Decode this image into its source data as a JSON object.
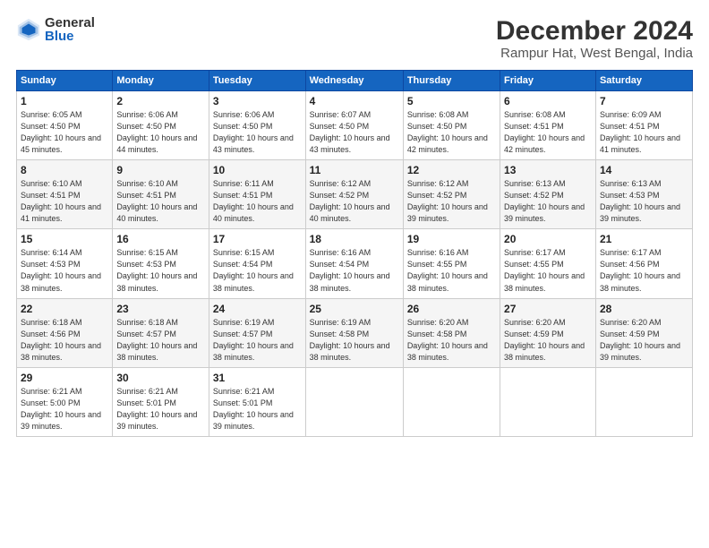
{
  "logo": {
    "general": "General",
    "blue": "Blue"
  },
  "title": "December 2024",
  "subtitle": "Rampur Hat, West Bengal, India",
  "weekdays": [
    "Sunday",
    "Monday",
    "Tuesday",
    "Wednesday",
    "Thursday",
    "Friday",
    "Saturday"
  ],
  "weeks": [
    [
      {
        "day": "1",
        "sunrise": "6:05 AM",
        "sunset": "4:50 PM",
        "daylight": "10 hours and 45 minutes."
      },
      {
        "day": "2",
        "sunrise": "6:06 AM",
        "sunset": "4:50 PM",
        "daylight": "10 hours and 44 minutes."
      },
      {
        "day": "3",
        "sunrise": "6:06 AM",
        "sunset": "4:50 PM",
        "daylight": "10 hours and 43 minutes."
      },
      {
        "day": "4",
        "sunrise": "6:07 AM",
        "sunset": "4:50 PM",
        "daylight": "10 hours and 43 minutes."
      },
      {
        "day": "5",
        "sunrise": "6:08 AM",
        "sunset": "4:50 PM",
        "daylight": "10 hours and 42 minutes."
      },
      {
        "day": "6",
        "sunrise": "6:08 AM",
        "sunset": "4:51 PM",
        "daylight": "10 hours and 42 minutes."
      },
      {
        "day": "7",
        "sunrise": "6:09 AM",
        "sunset": "4:51 PM",
        "daylight": "10 hours and 41 minutes."
      }
    ],
    [
      {
        "day": "8",
        "sunrise": "6:10 AM",
        "sunset": "4:51 PM",
        "daylight": "10 hours and 41 minutes."
      },
      {
        "day": "9",
        "sunrise": "6:10 AM",
        "sunset": "4:51 PM",
        "daylight": "10 hours and 40 minutes."
      },
      {
        "day": "10",
        "sunrise": "6:11 AM",
        "sunset": "4:51 PM",
        "daylight": "10 hours and 40 minutes."
      },
      {
        "day": "11",
        "sunrise": "6:12 AM",
        "sunset": "4:52 PM",
        "daylight": "10 hours and 40 minutes."
      },
      {
        "day": "12",
        "sunrise": "6:12 AM",
        "sunset": "4:52 PM",
        "daylight": "10 hours and 39 minutes."
      },
      {
        "day": "13",
        "sunrise": "6:13 AM",
        "sunset": "4:52 PM",
        "daylight": "10 hours and 39 minutes."
      },
      {
        "day": "14",
        "sunrise": "6:13 AM",
        "sunset": "4:53 PM",
        "daylight": "10 hours and 39 minutes."
      }
    ],
    [
      {
        "day": "15",
        "sunrise": "6:14 AM",
        "sunset": "4:53 PM",
        "daylight": "10 hours and 38 minutes."
      },
      {
        "day": "16",
        "sunrise": "6:15 AM",
        "sunset": "4:53 PM",
        "daylight": "10 hours and 38 minutes."
      },
      {
        "day": "17",
        "sunrise": "6:15 AM",
        "sunset": "4:54 PM",
        "daylight": "10 hours and 38 minutes."
      },
      {
        "day": "18",
        "sunrise": "6:16 AM",
        "sunset": "4:54 PM",
        "daylight": "10 hours and 38 minutes."
      },
      {
        "day": "19",
        "sunrise": "6:16 AM",
        "sunset": "4:55 PM",
        "daylight": "10 hours and 38 minutes."
      },
      {
        "day": "20",
        "sunrise": "6:17 AM",
        "sunset": "4:55 PM",
        "daylight": "10 hours and 38 minutes."
      },
      {
        "day": "21",
        "sunrise": "6:17 AM",
        "sunset": "4:56 PM",
        "daylight": "10 hours and 38 minutes."
      }
    ],
    [
      {
        "day": "22",
        "sunrise": "6:18 AM",
        "sunset": "4:56 PM",
        "daylight": "10 hours and 38 minutes."
      },
      {
        "day": "23",
        "sunrise": "6:18 AM",
        "sunset": "4:57 PM",
        "daylight": "10 hours and 38 minutes."
      },
      {
        "day": "24",
        "sunrise": "6:19 AM",
        "sunset": "4:57 PM",
        "daylight": "10 hours and 38 minutes."
      },
      {
        "day": "25",
        "sunrise": "6:19 AM",
        "sunset": "4:58 PM",
        "daylight": "10 hours and 38 minutes."
      },
      {
        "day": "26",
        "sunrise": "6:20 AM",
        "sunset": "4:58 PM",
        "daylight": "10 hours and 38 minutes."
      },
      {
        "day": "27",
        "sunrise": "6:20 AM",
        "sunset": "4:59 PM",
        "daylight": "10 hours and 38 minutes."
      },
      {
        "day": "28",
        "sunrise": "6:20 AM",
        "sunset": "4:59 PM",
        "daylight": "10 hours and 39 minutes."
      }
    ],
    [
      {
        "day": "29",
        "sunrise": "6:21 AM",
        "sunset": "5:00 PM",
        "daylight": "10 hours and 39 minutes."
      },
      {
        "day": "30",
        "sunrise": "6:21 AM",
        "sunset": "5:01 PM",
        "daylight": "10 hours and 39 minutes."
      },
      {
        "day": "31",
        "sunrise": "6:21 AM",
        "sunset": "5:01 PM",
        "daylight": "10 hours and 39 minutes."
      },
      null,
      null,
      null,
      null
    ]
  ]
}
